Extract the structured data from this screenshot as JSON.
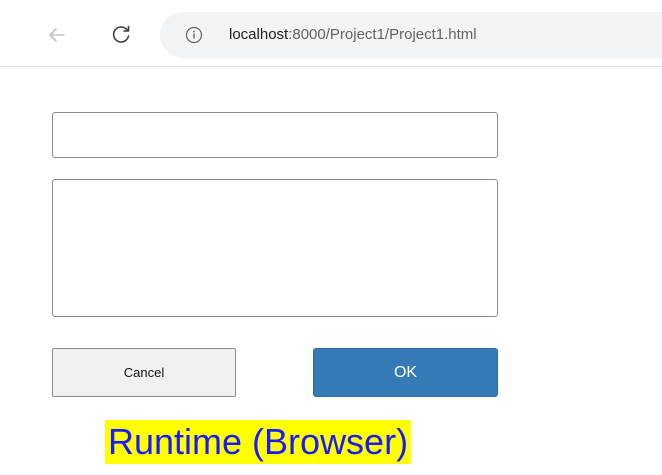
{
  "browser": {
    "url_host": "localhost",
    "url_rest": ":8000/Project1/Project1.html",
    "icons": {
      "back": "back-arrow-icon",
      "reload": "reload-icon",
      "info": "info-icon"
    }
  },
  "form": {
    "text_input": {
      "value": "",
      "placeholder": ""
    },
    "text_area": {
      "value": "",
      "placeholder": ""
    },
    "cancel_label": "Cancel",
    "ok_label": "OK"
  },
  "caption": {
    "text": "Runtime (Browser)"
  },
  "colors": {
    "ok_button_bg": "#337ab7",
    "cancel_button_bg": "#f0f0f0",
    "caption_bg": "#ffff00",
    "caption_text": "#1a1aff",
    "address_bar_bg": "#f1f3f4"
  }
}
